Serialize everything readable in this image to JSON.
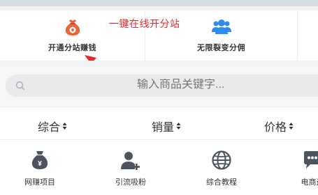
{
  "promo": {
    "items": [
      {
        "label": "开通分站赚钱",
        "icon": "money-bag-icon"
      },
      {
        "label": "无限裂变分佣",
        "icon": "users-group-icon"
      }
    ],
    "annotation": "一键在线开分站"
  },
  "search": {
    "placeholder": "输入商品关键字..."
  },
  "sort": {
    "items": [
      {
        "label": "综合"
      },
      {
        "label": "销量"
      },
      {
        "label": "价格"
      }
    ]
  },
  "categories": [
    {
      "label": "网赚项目",
      "icon": "money-bag-icon"
    },
    {
      "label": "引流吸粉",
      "icon": "add-user-icon"
    },
    {
      "label": "综合教程",
      "icon": "globe-icon"
    },
    {
      "label": "电商运",
      "icon": "chat-icon"
    }
  ],
  "colors": {
    "accent_red": "#e8282e",
    "icon_orange": "#e8663a",
    "icon_blue": "#2d8cf0",
    "icon_gray": "#4a5560"
  }
}
